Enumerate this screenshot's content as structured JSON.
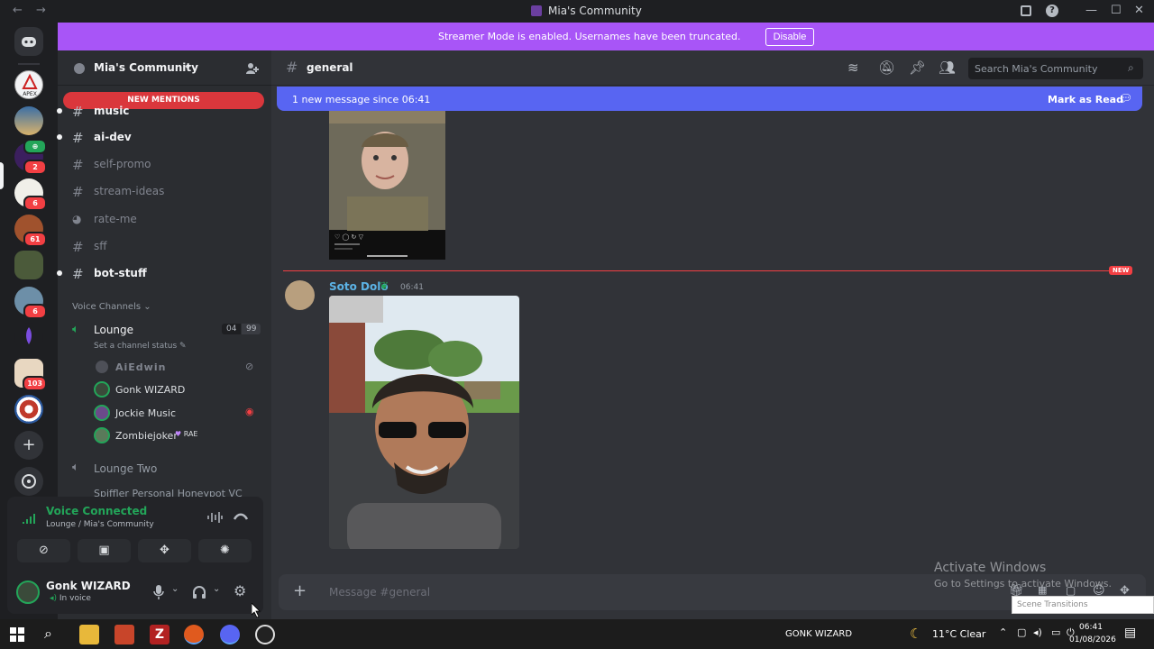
{
  "window": {
    "title": "Mia's Community",
    "back": "←",
    "forward": "→",
    "inbox_icon": "inbox-icon",
    "help_icon": "?",
    "minimize": "—",
    "maximize": "☐",
    "close": "✕"
  },
  "streamer_bar": {
    "message": "Streamer Mode is enabled. Usernames have been truncated.",
    "button": "Disable",
    "close": "✕"
  },
  "guilds": {
    "badges": [
      "2",
      "6",
      "61",
      "6",
      "6",
      "103"
    ]
  },
  "server": {
    "name": "Mia's Community",
    "chevron": "⌄"
  },
  "new_mentions": "NEW MENTIONS",
  "channels": [
    {
      "name": "music",
      "unread": true
    },
    {
      "name": "ai-dev",
      "unread": true
    },
    {
      "name": "self-promo",
      "unread": false
    },
    {
      "name": "stream-ideas",
      "unread": false
    },
    {
      "name": "rate-me",
      "unread": false
    },
    {
      "name": "sff",
      "unread": false
    },
    {
      "name": "bot-stuff",
      "unread": true
    }
  ],
  "voice_section": {
    "title": "Voice Channels",
    "lounge": "Lounge",
    "lounge_count_a": "04",
    "lounge_count_b": "99",
    "status": "Set a channel status",
    "users": [
      "AiEdwin",
      "Gonk WIZARD",
      "Jockie Music",
      "Zombiejoker"
    ],
    "zombie_tag": "RAE",
    "lounge_two": "Lounge Two",
    "cut_channel": "Spiffler Personal Honeypot VC"
  },
  "voice_panel": {
    "status": "Voice Connected",
    "location": "Lounge / Mia's Community"
  },
  "user_panel": {
    "name": "Gonk WIZARD",
    "status": "In voice"
  },
  "chat": {
    "channel": "general",
    "search_placeholder": "Search Mia's Community",
    "new_message_text": "1 new message since 06:41",
    "mark_as_read": "Mark as Read",
    "new_label": "NEW",
    "author": "Soto Dolo",
    "time": "06:41",
    "composer_placeholder": "Message #general"
  },
  "watermark": {
    "line1": "Activate Windows",
    "line2": "Go to Settings to activate Windows."
  },
  "scene_popup": "Scene Transitions",
  "taskbar": {
    "user": "GONK WIZARD",
    "weather": "11°C  Clear",
    "time": "06:41",
    "date": "01/08/2026"
  },
  "colors": {
    "streamer": "#a855f7",
    "blurple": "#5865f2",
    "red": "#f23f43",
    "green": "#23a559"
  }
}
